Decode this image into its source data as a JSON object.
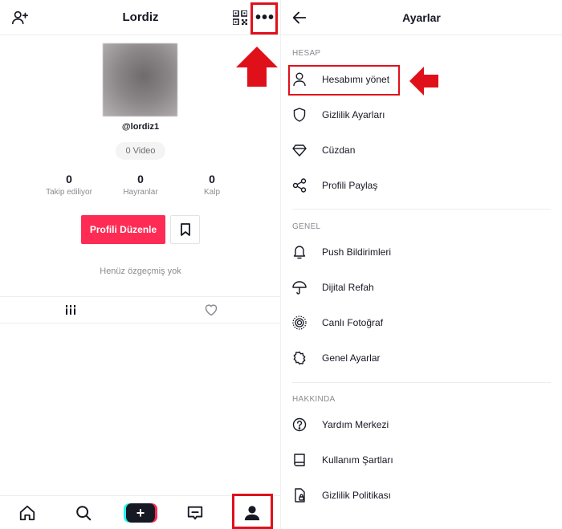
{
  "profile": {
    "title": "Lordiz",
    "username": "@lordiz1",
    "video_count": "0 Video",
    "stats": [
      {
        "value": "0",
        "label": "Takip ediliyor"
      },
      {
        "value": "0",
        "label": "Hayranlar"
      },
      {
        "value": "0",
        "label": "Kalp"
      }
    ],
    "edit_button": "Profili Düzenle",
    "bio": "Henüz özgeçmiş yok"
  },
  "settings": {
    "title": "Ayarlar",
    "sections": [
      {
        "header": "HESAP",
        "items": [
          {
            "label": "Hesabımı yönet",
            "icon": "person-icon"
          },
          {
            "label": "Gizlilik Ayarları",
            "icon": "shield-icon"
          },
          {
            "label": "Cüzdan",
            "icon": "diamond-icon"
          },
          {
            "label": "Profili Paylaş",
            "icon": "share-icon"
          }
        ]
      },
      {
        "header": "GENEL",
        "items": [
          {
            "label": "Push Bildirimleri",
            "icon": "bell-icon"
          },
          {
            "label": "Dijital Refah",
            "icon": "umbrella-icon"
          },
          {
            "label": "Canlı Fotoğraf",
            "icon": "live-photo-icon"
          },
          {
            "label": "Genel Ayarlar",
            "icon": "gear-icon"
          }
        ]
      },
      {
        "header": "HAKKINDA",
        "items": [
          {
            "label": "Yardım Merkezi",
            "icon": "help-icon"
          },
          {
            "label": "Kullanım Şartları",
            "icon": "book-icon"
          },
          {
            "label": "Gizlilik Politikası",
            "icon": "privacy-document-icon"
          }
        ]
      }
    ]
  },
  "colors": {
    "accent": "#fe2c55",
    "annotation_red": "#e0101b"
  }
}
